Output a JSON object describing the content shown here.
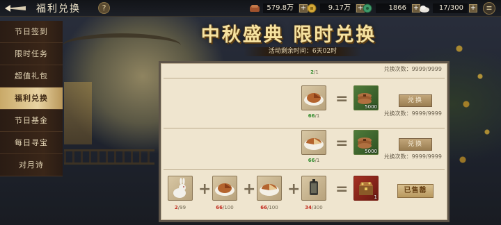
{
  "header": {
    "title": "福利兑换",
    "help_label": "?",
    "menu_label": "≡",
    "resources": [
      {
        "icon": "copper-icon",
        "value": "579.8万",
        "plus": "+"
      },
      {
        "icon": "gold-coin-icon",
        "value": "9.17万",
        "plus": "+"
      },
      {
        "icon": "jade-icon",
        "value": "1866",
        "plus": "+"
      },
      {
        "icon": "stamina-icon",
        "value": "17/300",
        "plus": "+"
      }
    ]
  },
  "sidebar": {
    "items": [
      {
        "label": "节日签到",
        "active": false
      },
      {
        "label": "限时任务",
        "active": false
      },
      {
        "label": "超值礼包",
        "active": false
      },
      {
        "label": "福利兑换",
        "active": true
      },
      {
        "label": "节日基金",
        "active": false
      },
      {
        "label": "每日寻宝",
        "active": false
      },
      {
        "label": "对月诗",
        "active": false
      }
    ]
  },
  "event": {
    "title": "中秋盛典 限时兑换",
    "countdown": "活动剩余时间：6天02时"
  },
  "exchange": {
    "rows": [
      {
        "cost_qty_have": "2",
        "cost_qty_need": "/1",
        "count_text": "兑换次数：9999/9999"
      },
      {
        "cost_icon": "mooncake-icon",
        "cost_qty_have": "66",
        "cost_qty_need": "/1",
        "reward_icon": "copper-coins-icon",
        "reward_badge": "5000",
        "button_label": "兑换",
        "count_text": "兑换次数：9999/9999"
      },
      {
        "cost_icon": "mooncake-slice-icon",
        "cost_qty_have": "66",
        "cost_qty_need": "/1",
        "reward_icon": "copper-coins-icon",
        "reward_badge": "5000",
        "button_label": "兑换",
        "count_text": "兑换次数：9999/9999"
      },
      {
        "costs": [
          {
            "icon": "rabbit-icon",
            "have": "2",
            "need": "/99",
            "enough": false
          },
          {
            "icon": "mooncake-icon",
            "have": "66",
            "need": "/100",
            "enough": false
          },
          {
            "icon": "mooncake-slice-icon",
            "have": "66",
            "need": "/100",
            "enough": false
          },
          {
            "icon": "lantern-token-icon",
            "have": "34",
            "need": "/300",
            "enough": false
          }
        ],
        "reward_icon": "treasure-chest-icon",
        "reward_badge": "1",
        "button_label": "已售罄"
      }
    ],
    "equals": "=",
    "plus": "+"
  }
}
